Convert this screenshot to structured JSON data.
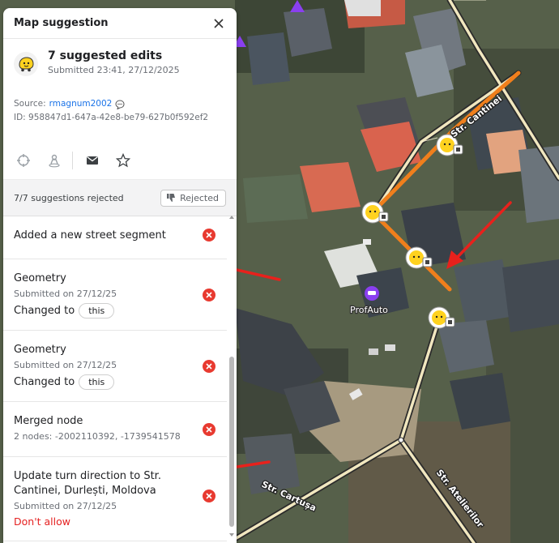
{
  "panel": {
    "title": "Map suggestion",
    "summary": {
      "title": "7 suggested edits",
      "submitted": "Submitted 23:41, 27/12/2025"
    },
    "meta": {
      "source_label": "Source:",
      "source_user": "rmagnum2002",
      "id_text": "ID: 958847d1-647a-42e8-be79-627b0f592ef2"
    },
    "actions": [
      "crosshair-icon",
      "person-pin-icon",
      "mail-icon",
      "star-icon"
    ],
    "status": {
      "text": "7/7 suggestions rejected",
      "badge": "Rejected"
    },
    "items": [
      {
        "title": "Added a new street segment"
      },
      {
        "title": "Geometry",
        "sub": "Submitted on 27/12/25",
        "change_label": "Changed to",
        "change_value": "this"
      },
      {
        "title": "Geometry",
        "sub": "Submitted on 27/12/25",
        "change_label": "Changed to",
        "change_value": "this"
      },
      {
        "title": "Merged node",
        "sub": "2 nodes: -2002110392, -1739541578"
      },
      {
        "title": "Update turn direction to Str. Cantinei, Durlești, Moldova",
        "sub": "Submitted on 27/12/25",
        "deny": "Don't allow"
      }
    ]
  },
  "map": {
    "street_labels": [
      "Str. Cantinei",
      "Str. Cartușa",
      "Str. Atelierilor"
    ],
    "poi_label": "ProfAuto",
    "colors": {
      "edit_line": "#f07f1c",
      "arrow": "#e8211c",
      "road": "#f1e7bf",
      "poi": "#8a3ff0"
    }
  }
}
